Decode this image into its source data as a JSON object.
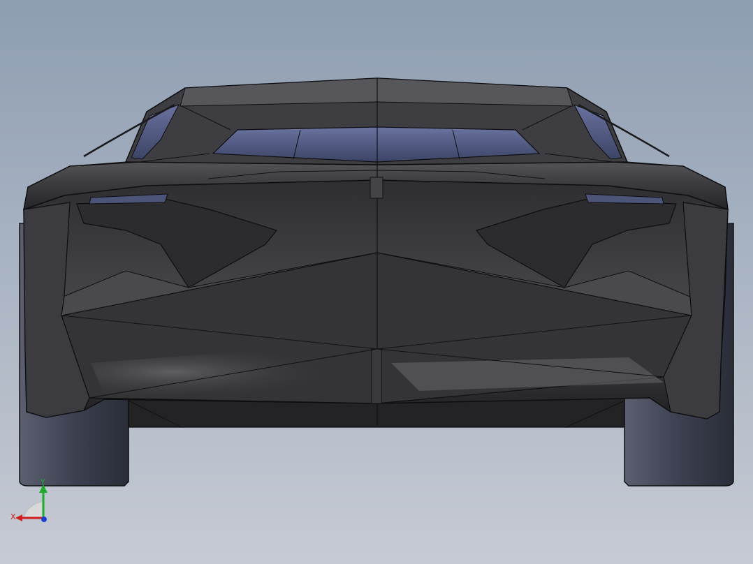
{
  "viewport": {
    "background_top": "#8e9db1",
    "background_bottom": "#c6cad3"
  },
  "model": {
    "body_color": "#3a3a3c",
    "glass_color": "#5c6688",
    "tire_color": "#3f4352",
    "edge_color": "#0e0e10"
  },
  "triad": {
    "x_label": "X",
    "y_label": "Y",
    "x_color": "#d01e1e",
    "y_color": "#1faa2b",
    "z_color": "#1c3fd6"
  }
}
